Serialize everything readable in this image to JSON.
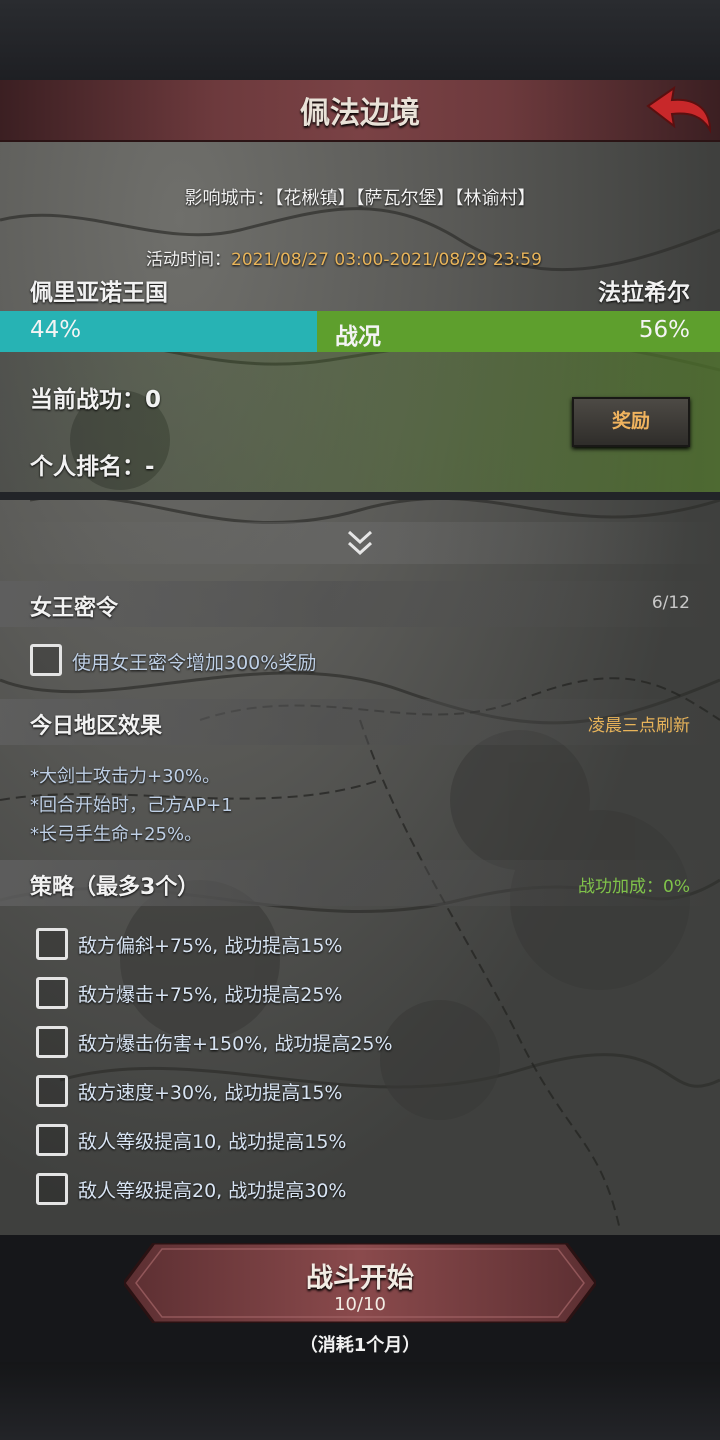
{
  "header": {
    "title": "佩法边境"
  },
  "info": {
    "cities": "影响城市：【花楸镇】【萨瓦尔堡】【林谕村】",
    "time_label": "活动时间：",
    "time_value": "2021/08/27 03:00-2021/08/29 23:59"
  },
  "war": {
    "left_faction": "佩里亚诺王国",
    "right_faction": "法拉希尔",
    "left_pct": "44%",
    "right_pct": "56%",
    "left_share": 0.44,
    "status_label": "战况",
    "left_color": "#27b3b4",
    "right_color": "#5e9f2d"
  },
  "personal": {
    "merit": "当前战功：0",
    "rank": "个人排名：-",
    "reward_label": "奖励"
  },
  "queen": {
    "title": "女王密令",
    "count": "6/12",
    "option": "使用女王密令增加300%奖励"
  },
  "region": {
    "title": "今日地区效果",
    "refresh": "凌晨三点刷新",
    "effects": [
      "*大剑士攻击力+30%。",
      "*回合开始时，己方AP+1",
      "*长弓手生命+25%。"
    ]
  },
  "strategy": {
    "title": "策略（最多3个）",
    "bonus": "战功加成：0%",
    "options": [
      "敌方偏斜+75%, 战功提高15%",
      "敌方爆击+75%, 战功提高25%",
      "敌方爆击伤害+150%, 战功提高25%",
      "敌方速度+30%, 战功提高15%",
      "敌人等级提高10, 战功提高15%",
      "敌人等级提高20, 战功提高30%"
    ]
  },
  "battle": {
    "start_label": "战斗开始",
    "count": "10/10",
    "consume": "（消耗1个月）"
  },
  "colors": {
    "gold": "#e8b45a",
    "green_text": "#7fc24a",
    "title_bar": "#7a4245",
    "back_arrow": "#c8282a"
  }
}
